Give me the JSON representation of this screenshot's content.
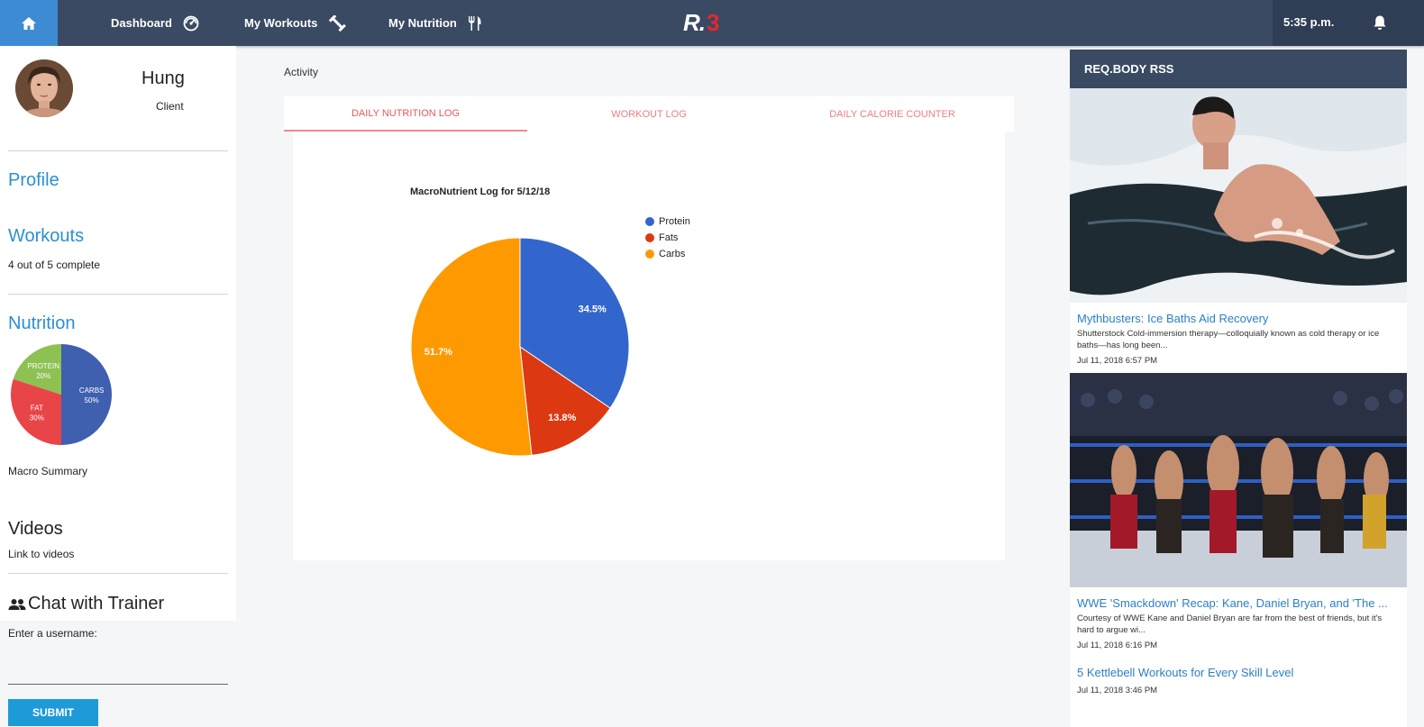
{
  "nav": {
    "dashboard": "Dashboard",
    "workouts": "My Workouts",
    "nutrition": "My Nutrition",
    "logo_r": "R.",
    "logo_3": "3",
    "time": "5:35 p.m."
  },
  "colors": {
    "nav_bg": "#394a62",
    "accent_blue": "#3d8bd3",
    "link_blue": "#2a8fd6",
    "protein": "#3366cc",
    "fats": "#dc3912",
    "carbs": "#ff9900"
  },
  "sidebar": {
    "name": "Hung",
    "role": "Client",
    "profile": "Profile",
    "workouts": "Workouts",
    "workouts_status": "4 out of 5 complete",
    "nutrition": "Nutrition",
    "mini_pie": {
      "slices": [
        {
          "label": "CARBS",
          "pct_label": "50%",
          "value": 50,
          "color": "#3f5faf"
        },
        {
          "label": "FAT",
          "pct_label": "30%",
          "value": 30,
          "color": "#e84548"
        },
        {
          "label": "PROTEIN",
          "pct_label": "20%",
          "value": 20,
          "color": "#8dc152"
        }
      ]
    },
    "macro_summary": "Macro Summary",
    "videos": "Videos",
    "videos_link": "Link to videos",
    "chat": "Chat with Trainer",
    "username_label": "Enter a username:",
    "submit": "SUBMIT"
  },
  "main": {
    "activity": "Activity",
    "tabs": [
      "DAILY NUTRITION LOG",
      "WORKOUT LOG",
      "DAILY CALORIE COUNTER"
    ]
  },
  "chart_data": {
    "type": "pie",
    "title": "MacroNutrient Log for 5/12/18",
    "legend_position": "right",
    "slices": [
      {
        "name": "Protein",
        "value": 34.5,
        "label": "34.5%",
        "color": "#3366cc"
      },
      {
        "name": "Fats",
        "value": 13.8,
        "label": "13.8%",
        "color": "#dc3912"
      },
      {
        "name": "Carbs",
        "value": 51.7,
        "label": "51.7%",
        "color": "#ff9900"
      }
    ]
  },
  "rss": {
    "header": "REQ.BODY RSS",
    "items": [
      {
        "title": "Mythbusters: Ice Baths Aid Recovery",
        "desc": "Shutterstock Cold-immersion therapy—colloquially known as cold therapy or ice baths—has long been...",
        "date": "Jul 11, 2018 6:57 PM"
      },
      {
        "title": "WWE 'Smackdown' Recap: Kane, Daniel Bryan, and 'The ...",
        "desc": "Courtesy of WWE Kane and Daniel Bryan are far from the best of friends, but it's hard to argue wi...",
        "date": "Jul 11, 2018 6:16 PM"
      },
      {
        "title": "5 Kettlebell Workouts for Every Skill Level",
        "date": "Jul 11, 2018 3:46 PM"
      }
    ]
  }
}
